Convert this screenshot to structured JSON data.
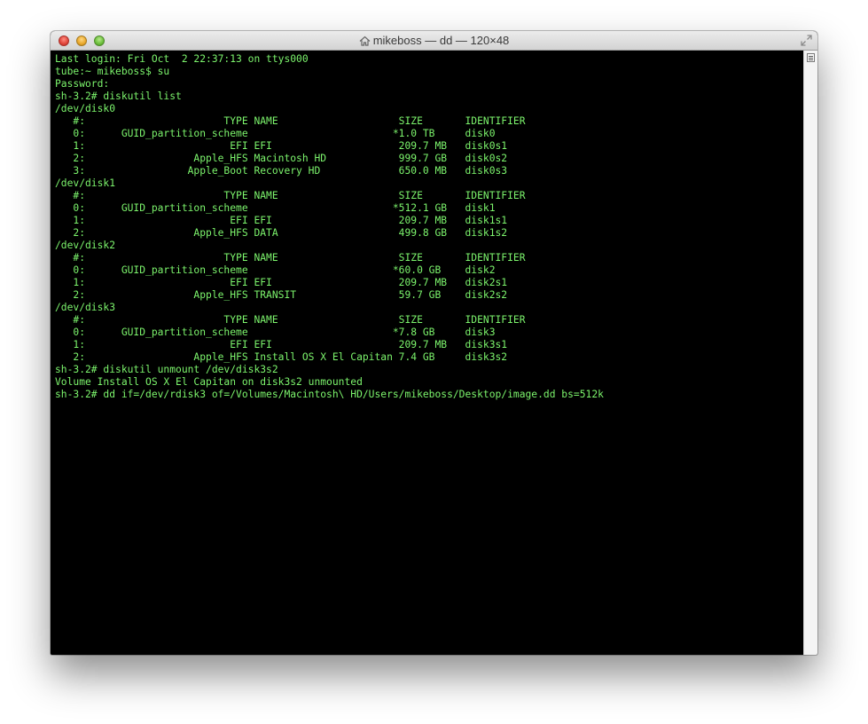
{
  "window": {
    "title": "mikeboss — dd — 120×48"
  },
  "colors": {
    "terminal_bg": "#000000",
    "terminal_text": "#7cf46c"
  },
  "icons": {
    "title": "home-icon",
    "resize": "fullscreen-arrows-icon",
    "scroll": "split-pane-icon"
  },
  "terminal": {
    "lines": [
      "Last login: Fri Oct  2 22:37:13 on ttys000",
      "tube:~ mikeboss$ su",
      "Password:",
      "sh-3.2# diskutil list",
      "/dev/disk0",
      "   #:                       TYPE NAME                    SIZE       IDENTIFIER",
      "   0:      GUID_partition_scheme                        *1.0 TB     disk0",
      "   1:                        EFI EFI                     209.7 MB   disk0s1",
      "   2:                  Apple_HFS Macintosh HD            999.7 GB   disk0s2",
      "   3:                 Apple_Boot Recovery HD             650.0 MB   disk0s3",
      "/dev/disk1",
      "   #:                       TYPE NAME                    SIZE       IDENTIFIER",
      "   0:      GUID_partition_scheme                        *512.1 GB   disk1",
      "   1:                        EFI EFI                     209.7 MB   disk1s1",
      "   2:                  Apple_HFS DATA                    499.8 GB   disk1s2",
      "/dev/disk2",
      "   #:                       TYPE NAME                    SIZE       IDENTIFIER",
      "   0:      GUID_partition_scheme                        *60.0 GB    disk2",
      "   1:                        EFI EFI                     209.7 MB   disk2s1",
      "   2:                  Apple_HFS TRANSIT                 59.7 GB    disk2s2",
      "/dev/disk3",
      "   #:                       TYPE NAME                    SIZE       IDENTIFIER",
      "   0:      GUID_partition_scheme                        *7.8 GB     disk3",
      "   1:                        EFI EFI                     209.7 MB   disk3s1",
      "   2:                  Apple_HFS Install OS X El Capitan 7.4 GB     disk3s2",
      "sh-3.2# diskutil unmount /dev/disk3s2",
      "Volume Install OS X El Capitan on disk3s2 unmounted",
      "sh-3.2# dd if=/dev/rdisk3 of=/Volumes/Macintosh\\ HD/Users/mikeboss/Desktop/image.dd bs=512k"
    ]
  }
}
